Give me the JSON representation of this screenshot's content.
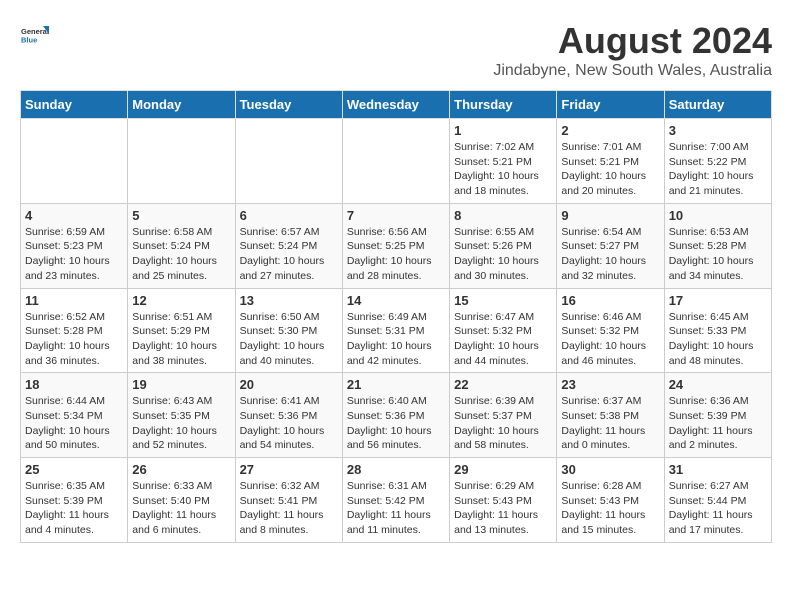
{
  "logo": {
    "line1": "General",
    "line2": "Blue"
  },
  "title": "August 2024",
  "subtitle": "Jindabyne, New South Wales, Australia",
  "days_of_week": [
    "Sunday",
    "Monday",
    "Tuesday",
    "Wednesday",
    "Thursday",
    "Friday",
    "Saturday"
  ],
  "weeks": [
    [
      {
        "day": "",
        "info": ""
      },
      {
        "day": "",
        "info": ""
      },
      {
        "day": "",
        "info": ""
      },
      {
        "day": "",
        "info": ""
      },
      {
        "day": "1",
        "info": "Sunrise: 7:02 AM\nSunset: 5:21 PM\nDaylight: 10 hours\nand 18 minutes."
      },
      {
        "day": "2",
        "info": "Sunrise: 7:01 AM\nSunset: 5:21 PM\nDaylight: 10 hours\nand 20 minutes."
      },
      {
        "day": "3",
        "info": "Sunrise: 7:00 AM\nSunset: 5:22 PM\nDaylight: 10 hours\nand 21 minutes."
      }
    ],
    [
      {
        "day": "4",
        "info": "Sunrise: 6:59 AM\nSunset: 5:23 PM\nDaylight: 10 hours\nand 23 minutes."
      },
      {
        "day": "5",
        "info": "Sunrise: 6:58 AM\nSunset: 5:24 PM\nDaylight: 10 hours\nand 25 minutes."
      },
      {
        "day": "6",
        "info": "Sunrise: 6:57 AM\nSunset: 5:24 PM\nDaylight: 10 hours\nand 27 minutes."
      },
      {
        "day": "7",
        "info": "Sunrise: 6:56 AM\nSunset: 5:25 PM\nDaylight: 10 hours\nand 28 minutes."
      },
      {
        "day": "8",
        "info": "Sunrise: 6:55 AM\nSunset: 5:26 PM\nDaylight: 10 hours\nand 30 minutes."
      },
      {
        "day": "9",
        "info": "Sunrise: 6:54 AM\nSunset: 5:27 PM\nDaylight: 10 hours\nand 32 minutes."
      },
      {
        "day": "10",
        "info": "Sunrise: 6:53 AM\nSunset: 5:28 PM\nDaylight: 10 hours\nand 34 minutes."
      }
    ],
    [
      {
        "day": "11",
        "info": "Sunrise: 6:52 AM\nSunset: 5:28 PM\nDaylight: 10 hours\nand 36 minutes."
      },
      {
        "day": "12",
        "info": "Sunrise: 6:51 AM\nSunset: 5:29 PM\nDaylight: 10 hours\nand 38 minutes."
      },
      {
        "day": "13",
        "info": "Sunrise: 6:50 AM\nSunset: 5:30 PM\nDaylight: 10 hours\nand 40 minutes."
      },
      {
        "day": "14",
        "info": "Sunrise: 6:49 AM\nSunset: 5:31 PM\nDaylight: 10 hours\nand 42 minutes."
      },
      {
        "day": "15",
        "info": "Sunrise: 6:47 AM\nSunset: 5:32 PM\nDaylight: 10 hours\nand 44 minutes."
      },
      {
        "day": "16",
        "info": "Sunrise: 6:46 AM\nSunset: 5:32 PM\nDaylight: 10 hours\nand 46 minutes."
      },
      {
        "day": "17",
        "info": "Sunrise: 6:45 AM\nSunset: 5:33 PM\nDaylight: 10 hours\nand 48 minutes."
      }
    ],
    [
      {
        "day": "18",
        "info": "Sunrise: 6:44 AM\nSunset: 5:34 PM\nDaylight: 10 hours\nand 50 minutes."
      },
      {
        "day": "19",
        "info": "Sunrise: 6:43 AM\nSunset: 5:35 PM\nDaylight: 10 hours\nand 52 minutes."
      },
      {
        "day": "20",
        "info": "Sunrise: 6:41 AM\nSunset: 5:36 PM\nDaylight: 10 hours\nand 54 minutes."
      },
      {
        "day": "21",
        "info": "Sunrise: 6:40 AM\nSunset: 5:36 PM\nDaylight: 10 hours\nand 56 minutes."
      },
      {
        "day": "22",
        "info": "Sunrise: 6:39 AM\nSunset: 5:37 PM\nDaylight: 10 hours\nand 58 minutes."
      },
      {
        "day": "23",
        "info": "Sunrise: 6:37 AM\nSunset: 5:38 PM\nDaylight: 11 hours\nand 0 minutes."
      },
      {
        "day": "24",
        "info": "Sunrise: 6:36 AM\nSunset: 5:39 PM\nDaylight: 11 hours\nand 2 minutes."
      }
    ],
    [
      {
        "day": "25",
        "info": "Sunrise: 6:35 AM\nSunset: 5:39 PM\nDaylight: 11 hours\nand 4 minutes."
      },
      {
        "day": "26",
        "info": "Sunrise: 6:33 AM\nSunset: 5:40 PM\nDaylight: 11 hours\nand 6 minutes."
      },
      {
        "day": "27",
        "info": "Sunrise: 6:32 AM\nSunset: 5:41 PM\nDaylight: 11 hours\nand 8 minutes."
      },
      {
        "day": "28",
        "info": "Sunrise: 6:31 AM\nSunset: 5:42 PM\nDaylight: 11 hours\nand 11 minutes."
      },
      {
        "day": "29",
        "info": "Sunrise: 6:29 AM\nSunset: 5:43 PM\nDaylight: 11 hours\nand 13 minutes."
      },
      {
        "day": "30",
        "info": "Sunrise: 6:28 AM\nSunset: 5:43 PM\nDaylight: 11 hours\nand 15 minutes."
      },
      {
        "day": "31",
        "info": "Sunrise: 6:27 AM\nSunset: 5:44 PM\nDaylight: 11 hours\nand 17 minutes."
      }
    ]
  ]
}
